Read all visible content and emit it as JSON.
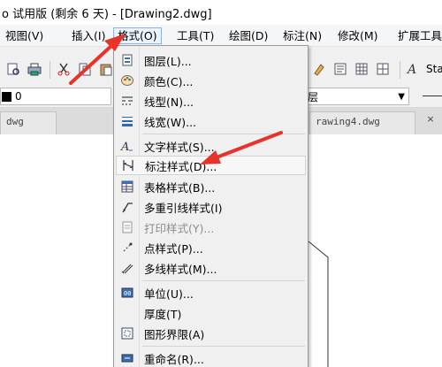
{
  "window": {
    "title": "o 试用版 (剩余 6 天) - [Drawing2.dwg]"
  },
  "menubar": {
    "items": [
      {
        "label": "视图(V)"
      },
      {
        "label": "插入(I)"
      },
      {
        "label": "格式(O)"
      },
      {
        "label": "工具(T)"
      },
      {
        "label": "绘图(D)"
      },
      {
        "label": "标注(N)"
      },
      {
        "label": "修改(M)"
      },
      {
        "label": "扩展工具"
      }
    ]
  },
  "toolbar": {
    "style_text": "Sta"
  },
  "properties": {
    "layer_value": "0",
    "right_combo_text": "层"
  },
  "tabs": {
    "left": "dwg",
    "right": "rawing4.dwg",
    "close_glyph": "×"
  },
  "format_menu": {
    "items": [
      {
        "label": "图层(L)...",
        "icon": "layers-icon"
      },
      {
        "label": "颜色(C)...",
        "icon": "palette-icon"
      },
      {
        "label": "线型(N)...",
        "icon": "linetype-icon"
      },
      {
        "label": "线宽(W)...",
        "icon": "lineweight-icon"
      },
      {
        "label": "文字样式(S)...",
        "icon": "text-style-icon"
      },
      {
        "label": "标注样式(D)...",
        "icon": "dimension-style-icon"
      },
      {
        "label": "表格样式(B)...",
        "icon": "table-style-icon"
      },
      {
        "label": "多重引线样式(I)",
        "icon": "multileader-style-icon"
      },
      {
        "label": "打印样式(Y)...",
        "icon": "plot-style-icon",
        "disabled": true
      },
      {
        "label": "点样式(P)...",
        "icon": "point-style-icon"
      },
      {
        "label": "多线样式(M)...",
        "icon": "multiline-style-icon"
      },
      {
        "label": "单位(U)...",
        "icon": "units-icon"
      },
      {
        "label": "厚度(T)",
        "icon": ""
      },
      {
        "label": "图形界限(A)",
        "icon": "drawing-limits-icon"
      },
      {
        "label": "重命名(R)...",
        "icon": "rename-icon"
      }
    ]
  },
  "colors": {
    "highlight_border": "#8fb3da",
    "arrow": "#e8332a"
  }
}
